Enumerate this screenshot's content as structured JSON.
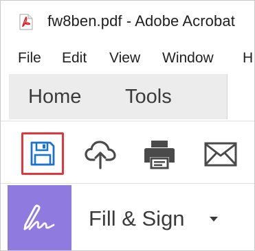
{
  "window": {
    "title": "fw8ben.pdf - Adobe Acrobat",
    "icon": "pdf-file-icon",
    "icon_color": "#d9262b"
  },
  "menu": {
    "items": [
      "File",
      "Edit",
      "View",
      "Window",
      "H"
    ]
  },
  "nav": {
    "tabs": [
      "Home",
      "Tools"
    ]
  },
  "toolbar": {
    "tools": [
      {
        "icon": "save-icon",
        "highlighted": true,
        "color": "#1a73c8"
      },
      {
        "icon": "cloud-upload-icon"
      },
      {
        "icon": "print-icon"
      },
      {
        "icon": "email-icon"
      }
    ],
    "highlight_color": "#e0363c"
  },
  "fill_sign": {
    "label": "Fill & Sign",
    "icon": "signature-pen-icon",
    "icon_bg": "#8f7be0"
  }
}
